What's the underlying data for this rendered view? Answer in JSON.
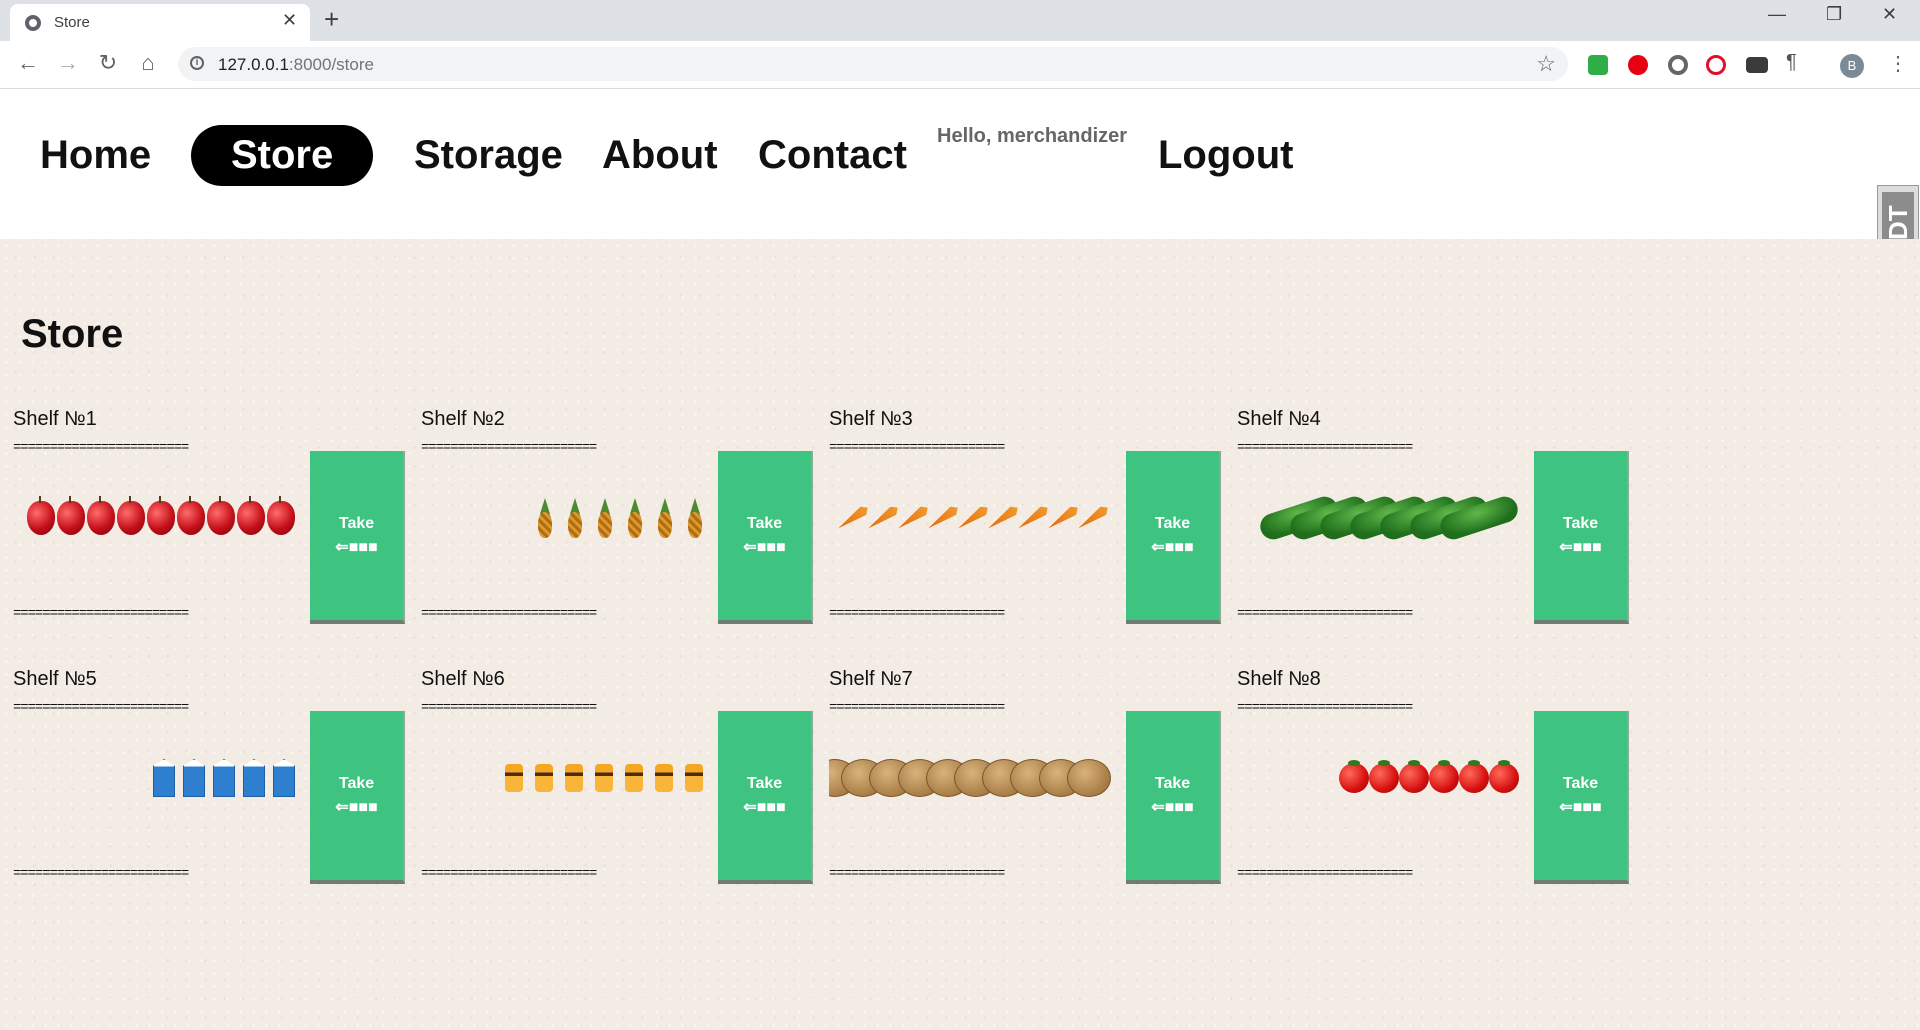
{
  "browser": {
    "tab_title": "Store",
    "url_host": "127.0.0.1",
    "url_path": ":8000/store",
    "profile_initial": "B"
  },
  "nav": {
    "home": "Home",
    "store": "Store",
    "storage": "Storage",
    "about": "About",
    "contact": "Contact",
    "greeting": "Hello, merchandizer",
    "logout": "Logout"
  },
  "debug_toolbar": {
    "label": "DjDT"
  },
  "page": {
    "title": "Store"
  },
  "shelf_rule": "========================",
  "take_button": {
    "label": "Take",
    "arrow": "⇐■■■"
  },
  "shelves": [
    {
      "label": "Shelf №1",
      "product": "apple",
      "count": 9
    },
    {
      "label": "Shelf №2",
      "product": "pineapple",
      "count": 6
    },
    {
      "label": "Shelf №3",
      "product": "carrot",
      "count": 9
    },
    {
      "label": "Shelf №4",
      "product": "cucumber",
      "count": 7
    },
    {
      "label": "Shelf №5",
      "product": "milk",
      "count": 5
    },
    {
      "label": "Shelf №6",
      "product": "juice",
      "count": 7
    },
    {
      "label": "Shelf №7",
      "product": "potato",
      "count": 10
    },
    {
      "label": "Shelf №8",
      "product": "tomato",
      "count": 6
    }
  ]
}
